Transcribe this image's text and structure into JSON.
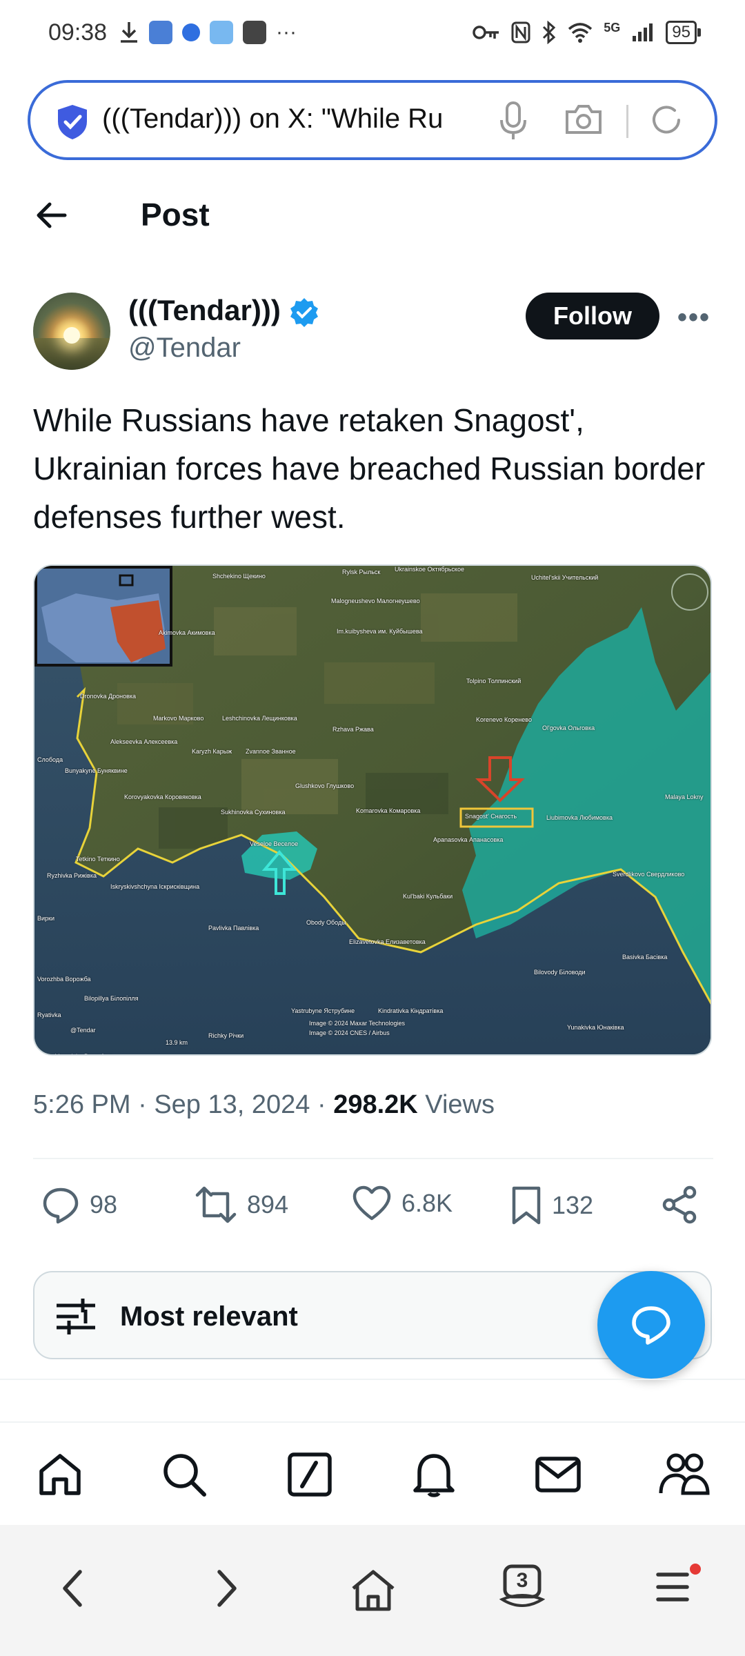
{
  "status_bar": {
    "time": "09:38",
    "network": "5G",
    "battery": "95"
  },
  "browser": {
    "url_text": "(((Tendar))) on X: \"While Ru",
    "tab_count": "3"
  },
  "header": {
    "title": "Post"
  },
  "author": {
    "display_name": "(((Tendar)))",
    "handle": "@Tendar",
    "follow_label": "Follow"
  },
  "post": {
    "text": "While Russians have retaken Snagost', Ukrainian forces have breached Russian border defenses further west.",
    "time": "5:26 PM",
    "date": "Sep 13, 2024",
    "views_count": "298.2K",
    "views_label": "Views"
  },
  "map": {
    "labels": [
      "Shchekino Щекино",
      "Rylsk Рыльск",
      "Ukrainskoe Октябрьское",
      "Uchitel'skii Учительский",
      "Malogneushevo Малогнеушево",
      "Im.kuibysheva им. Куйбышева",
      "Akimovka Акимовка",
      "Dronovka Дроновка",
      "Markovo Марково",
      "Leshchinovka Лещинковка",
      "Rzhava Ржава",
      "Tolpino Толпинский",
      "Korenevo Коренево",
      "Ol'govka Ольговка",
      "Alekseevka Алексеевка",
      "Karyzh Карыж",
      "Zvannoe Званное",
      "Bunyakyne Буняквине",
      "Слобода",
      "Glushkovo Глушково",
      "Korovyakovka Коровяковка",
      "Sukhinovka Сухиновка",
      "Komarovka Комаровка",
      "Snagost' Снагость",
      "Liubimovka Любимовка",
      "Malaya Lokny",
      "Apanasovka Апанасовка",
      "Veseloe Веселое",
      "Tetkino Теткино",
      "Ryzhivka Рижівка",
      "Iskryskivshchyna Іскрисківщина",
      "Kul'baki Кульбаки",
      "Sverdlikovo Свердликово",
      "Obody Ободы",
      "Вирки",
      "Pavlivka Павлівка",
      "Elizavetovka Елизаветовка",
      "Basivka Басівка",
      "Bilovody Біловоди",
      "Vorozhba Ворожба",
      "Bilopillya Білопілля",
      "Yastrubyne Яструбине",
      "Kindrativka Кіндратівка",
      "Yunakivka Юнаківка",
      "Richky Річки",
      "Voronivka Воронівка",
      "Ryativka",
      "13.9 km",
      "Image © 2024 Maxar Technologies",
      "Image © 2024 CNES / Airbus",
      "@Tendar"
    ]
  },
  "actions": {
    "replies": "98",
    "reposts": "894",
    "likes": "6.8K",
    "bookmarks": "132"
  },
  "replies_filter": {
    "label": "Most relevant"
  },
  "icons": {
    "back": "back-arrow-icon",
    "verified": "verified-badge-icon",
    "reply": "reply-icon",
    "repost": "repost-icon",
    "like": "heart-icon",
    "bookmark": "bookmark-icon",
    "share": "share-icon",
    "filter": "sliders-icon",
    "compose": "reply-compose-icon"
  },
  "colors": {
    "accent": "#1d9bf0",
    "url_border": "#3a6bd8",
    "text_primary": "#0f1419",
    "text_secondary": "#536471",
    "map_teal": "#1fa89a",
    "map_border": "#e8d33a"
  }
}
